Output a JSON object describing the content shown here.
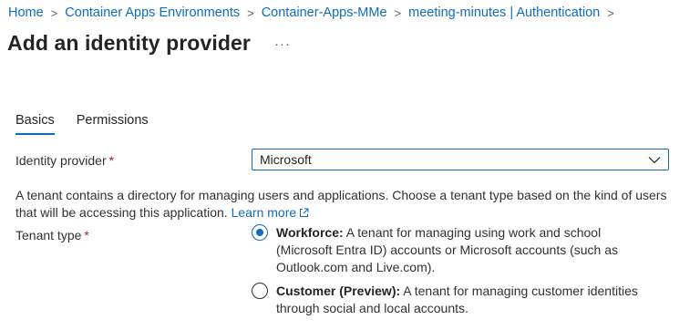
{
  "breadcrumb": {
    "items": [
      "Home",
      "Container Apps Environments",
      "Container-Apps-MMe",
      "meeting-minutes | Authentication"
    ],
    "separator": ">"
  },
  "page": {
    "title": "Add an identity provider",
    "more_label": "···"
  },
  "tabs": [
    {
      "label": "Basics",
      "active": true
    },
    {
      "label": "Permissions",
      "active": false
    }
  ],
  "form": {
    "identity_provider": {
      "label": "Identity provider",
      "required_mark": "*",
      "value": "Microsoft"
    },
    "description": {
      "text": "A tenant contains a directory for managing users and applications. Choose a tenant type based on the kind of users that will be accessing this application.",
      "link": "Learn more"
    },
    "tenant_type": {
      "label": "Tenant type",
      "required_mark": "*",
      "options": [
        {
          "title": "Workforce:",
          "text": "A tenant for managing using work and school (Microsoft Entra ID) accounts or Microsoft accounts (such as Outlook.com and Live.com).",
          "selected": true
        },
        {
          "title": "Customer (Preview):",
          "text": "A tenant for managing customer identities through social and local accounts.",
          "selected": false
        }
      ]
    }
  },
  "colors": {
    "accent": "#0f6cbd",
    "required": "#a4262c",
    "text": "#323130"
  },
  "icons": [
    "chevron-right-icon",
    "chevron-down-icon",
    "external-link-icon",
    "more-icon"
  ]
}
